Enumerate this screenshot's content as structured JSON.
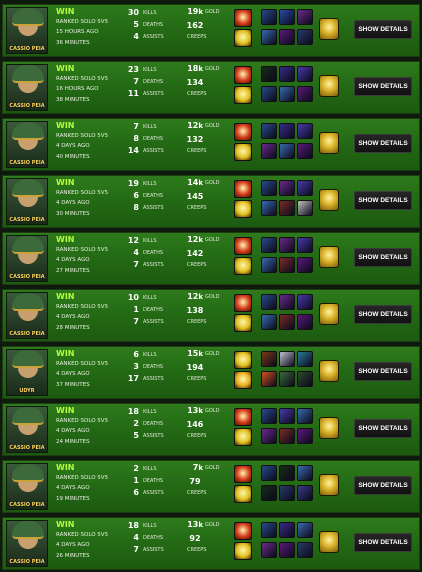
{
  "colors": {
    "win": "#b6ff3a",
    "row_bg_top": "#2e7a1c",
    "row_bg_bottom": "#1c5a10",
    "button_bg": "#1a1a1a"
  },
  "labels": {
    "kills": "KILLS",
    "deaths": "DEATHS",
    "assists": "ASSISTS",
    "gold": "GOLD",
    "creeps": "CREEPS",
    "show_details": "SHOW DETAILS",
    "gold_suffix": "k"
  },
  "matches": [
    {
      "champion": "CASSIO PEIA",
      "result": "WIN",
      "mode": "RANKED SOLO 5V5",
      "ago": "15 HOURS AGO",
      "duration": "36 MINUTES",
      "kills": "30",
      "deaths": "5",
      "assists": "4",
      "gold": "19",
      "creeps": "162",
      "spells": [
        "#d63a1a",
        "#e0c020"
      ],
      "items": [
        "#2a4a8a",
        "#2a4aaa",
        "#6a2a8a",
        "#3a6ab0",
        "#5a1a7a",
        "#2a3a6a",
        "#3a3a8a",
        "#1a4a7a"
      ]
    },
    {
      "champion": "CASSIO PEIA",
      "result": "WIN",
      "mode": "RANKED SOLO 5V5",
      "ago": "16 HOURS AGO",
      "duration": "38 MINUTES",
      "kills": "23",
      "deaths": "7",
      "assists": "11",
      "gold": "18",
      "creeps": "134",
      "spells": [
        "#d63a1a",
        "#e0c020"
      ],
      "items": [
        "#1a2a1a",
        "#3a2a8a",
        "#4a3aaa",
        "#2a4a8a",
        "#3a6ab0",
        "#5a1a7a",
        "#2a3a6a",
        "#1a4a7a"
      ]
    },
    {
      "champion": "CASSIO PEIA",
      "result": "WIN",
      "mode": "RANKED SOLO 5V5",
      "ago": "4 DAYS AGO",
      "duration": "40 MINUTES",
      "kills": "7",
      "deaths": "8",
      "assists": "14",
      "gold": "12",
      "creeps": "132",
      "spells": [
        "#d63a1a",
        "#e0c020"
      ],
      "items": [
        "#2a4a8a",
        "#3a2a8a",
        "#4a3aaa",
        "#6a2a8a",
        "#3a6ab0",
        "#5a1a7a",
        "#2a3a6a",
        "#3a3a8a"
      ]
    },
    {
      "champion": "CASSIO PEIA",
      "result": "WIN",
      "mode": "RANKED SOLO 5V5",
      "ago": "4 DAYS AGO",
      "duration": "30 MINUTES",
      "kills": "19",
      "deaths": "6",
      "assists": "8",
      "gold": "14",
      "creeps": "145",
      "spells": [
        "#d63a1a",
        "#e0c020"
      ],
      "items": [
        "#2a4a8a",
        "#6a2a8a",
        "#4a3aaa",
        "#3a6ab0",
        "#7a2a2a",
        "#c0c0c0",
        "#5a1a7a",
        "#2a3a6a"
      ]
    },
    {
      "champion": "CASSIO PEIA",
      "result": "WIN",
      "mode": "RANKED SOLO 5V5",
      "ago": "4 DAYS AGO",
      "duration": "27 MINUTES",
      "kills": "12",
      "deaths": "4",
      "assists": "7",
      "gold": "12",
      "creeps": "142",
      "spells": [
        "#d63a1a",
        "#e0c020"
      ],
      "items": [
        "#2a4a8a",
        "#6a2a8a",
        "#4a3aaa",
        "#3a6ab0",
        "#7a2a2a",
        "#5a1a7a",
        "#c0c0c0",
        "#2a3a6a"
      ]
    },
    {
      "champion": "CASSIO PEIA",
      "result": "WIN",
      "mode": "RANKED SOLO 5V5",
      "ago": "4 DAYS AGO",
      "duration": "28 MINUTES",
      "kills": "10",
      "deaths": "1",
      "assists": "7",
      "gold": "12",
      "creeps": "138",
      "spells": [
        "#d63a1a",
        "#e0c020"
      ],
      "items": [
        "#2a4a8a",
        "#6a2a8a",
        "#4a3aaa",
        "#3a6ab0",
        "#7a2a2a",
        "#5a1a7a",
        "#2a3a6a",
        "#3a3a8a"
      ]
    },
    {
      "champion": "UDYR",
      "result": "WIN",
      "mode": "RANKED SOLO 5V5",
      "ago": "4 DAYS AGO",
      "duration": "37 MINUTES",
      "kills": "6",
      "deaths": "3",
      "assists": "17",
      "gold": "15",
      "creeps": "194",
      "spells": [
        "#e0c020",
        "#e8b020"
      ],
      "items": [
        "#7a3a1a",
        "#c0c0d0",
        "#2a7a9a",
        "#d05020",
        "#3a6a3a",
        "#2a4a2a",
        "#1a3a6a",
        "#6a6a6a"
      ]
    },
    {
      "champion": "CASSIO PEIA",
      "result": "WIN",
      "mode": "RANKED SOLO 5V5",
      "ago": "4 DAYS AGO",
      "duration": "24 MINUTES",
      "kills": "18",
      "deaths": "2",
      "assists": "5",
      "gold": "13",
      "creeps": "146",
      "spells": [
        "#d63a1a",
        "#e0c020"
      ],
      "items": [
        "#2a4a8a",
        "#4a3aaa",
        "#3a6ab0",
        "#6a2a8a",
        "#7a2a2a",
        "#5a1a7a",
        "#2a3a6a",
        "#3a3a8a"
      ]
    },
    {
      "champion": "CASSIO PEIA",
      "result": "WIN",
      "mode": "RANKED SOLO 5V5",
      "ago": "4 DAYS AGO",
      "duration": "19 MINUTES",
      "kills": "2",
      "deaths": "1",
      "assists": "6",
      "gold": "7",
      "creeps": "79",
      "spells": [
        "#d63a1a",
        "#e0c020"
      ],
      "items": [
        "#2a4a8a",
        "#1a2a1a",
        "#3a6ab0",
        "#1a2a1a",
        "#2a3a6a",
        "#3a3a8a",
        "#1a4a7a",
        "#1a2a1a"
      ]
    },
    {
      "champion": "CASSIO PEIA",
      "result": "WIN",
      "mode": "RANKED SOLO 5V5",
      "ago": "4 DAYS AGO",
      "duration": "26 MINUTES",
      "kills": "18",
      "deaths": "4",
      "assists": "7",
      "gold": "13",
      "creeps": "92",
      "spells": [
        "#d63a1a",
        "#e0c020"
      ],
      "items": [
        "#2a4a8a",
        "#3a2a8a",
        "#3a6ab0",
        "#6a2a8a",
        "#5a1a7a",
        "#2a3a6a",
        "#7a2a2a",
        "#1a4a7a"
      ]
    }
  ]
}
